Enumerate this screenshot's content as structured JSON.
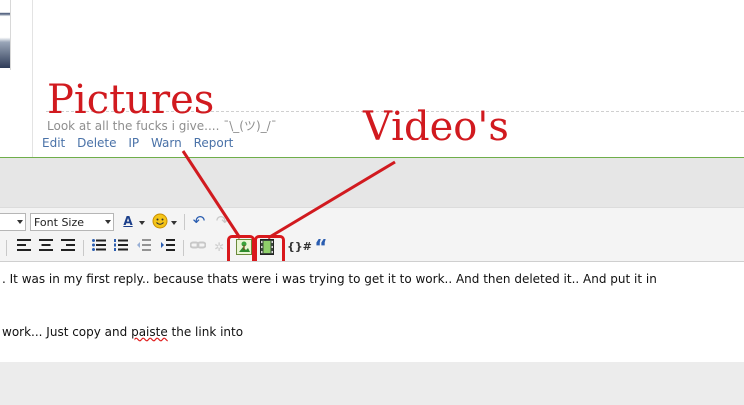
{
  "post": {
    "signature": "Look at all the fucks i give.... ¯\\_(ツ)_/¯",
    "actions": [
      "Edit",
      "Delete",
      "IP",
      "Warn",
      "Report"
    ]
  },
  "toolbar": {
    "font_size_label": "Font Size",
    "text_color_glyph": "A",
    "undo_glyph": "↶",
    "code_glyph": "{}#",
    "quote_glyph": "“"
  },
  "editor": {
    "line1": ". It was in my first reply.. because thats were i was trying to get it to work.. And then deleted it.. And put it in",
    "line2_before": "work... Just copy and ",
    "line2_misspelled": "paiste",
    "line2_after": " the link into"
  },
  "annotations": {
    "pictures_label": "Pictures",
    "videos_label": "Video's"
  },
  "colors": {
    "annotation_red": "#d11a1f",
    "link_blue": "#4a72a8",
    "separator_green": "#6fae4a"
  }
}
